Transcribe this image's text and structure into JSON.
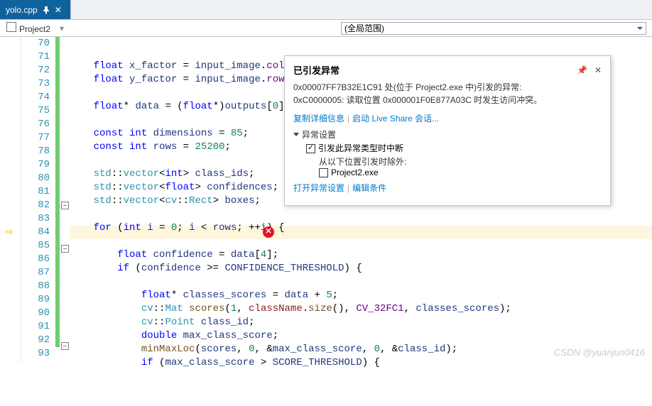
{
  "tab": {
    "name": "yolo.cpp"
  },
  "crumbs": {
    "project": "Project2",
    "scope": "(全局范围)"
  },
  "lineStart": 70,
  "highlightLine": 84,
  "codeLines": [
    {
      "n": 70,
      "g": 1,
      "html": "    <span class='kw'>float</span> <span class='id'>x_factor</span> <span class='op'>=</span> <span class='id'>input_image</span>.<span class='mem'>cols</span> <span class='op'>/</span> <span class='id'>INPUT_WIDTH</span>;"
    },
    {
      "n": 71,
      "g": 1,
      "html": "    <span class='kw'>float</span> <span class='id'>y_factor</span> <span class='op'>=</span> <span class='id'>input_image</span>.<span class='mem'>row</span>"
    },
    {
      "n": 72,
      "g": 1,
      "html": ""
    },
    {
      "n": 73,
      "g": 1,
      "html": "    <span class='kw'>float</span><span class='op'>*</span> <span class='id'>data</span> <span class='op'>=</span> (<span class='kw'>float</span><span class='op'>*</span>)<span class='id'>outputs</span>[<span class='num'>0</span>]"
    },
    {
      "n": 74,
      "g": 1,
      "html": ""
    },
    {
      "n": 75,
      "g": 1,
      "html": "    <span class='kw'>const</span> <span class='kw'>int</span> <span class='id'>dimensions</span> <span class='op'>=</span> <span class='num'>85</span>;"
    },
    {
      "n": 76,
      "g": 1,
      "html": "    <span class='kw'>const</span> <span class='kw'>int</span> <span class='id'>rows</span> <span class='op'>=</span> <span class='num'>25200</span>;"
    },
    {
      "n": 77,
      "g": 1,
      "html": ""
    },
    {
      "n": 78,
      "g": 1,
      "html": "    <span class='ty'>std</span>::<span class='ty'>vector</span>&lt;<span class='kw'>int</span>&gt; <span class='id'>class_ids</span>;"
    },
    {
      "n": 79,
      "g": 1,
      "html": "    <span class='ty'>std</span>::<span class='ty'>vector</span>&lt;<span class='kw'>float</span>&gt; <span class='id'>confidences</span>;"
    },
    {
      "n": 80,
      "g": 1,
      "html": "    <span class='ty'>std</span>::<span class='ty'>vector</span>&lt;<span class='ty'>cv</span>::<span class='ty'>Rect</span>&gt; <span class='id'>boxes</span>;"
    },
    {
      "n": 81,
      "g": 1,
      "html": ""
    },
    {
      "n": 82,
      "g": 1,
      "o": 1,
      "html": "    <span class='kw'>for</span> (<span class='kw'>int</span> <span class='id'>i</span> <span class='op'>=</span> <span class='num'>0</span>; <span class='id'>i</span> <span class='op'>&lt;</span> <span class='id'>rows</span>; <span class='op'>++</span><span class='id'>i</span>) {"
    },
    {
      "n": 83,
      "g": 1,
      "html": ""
    },
    {
      "n": 84,
      "g": 1,
      "html": "        <span class='kw'>float</span> <span class='id'>confidence</span> <span class='op'>=</span> <span class='id'>data</span>[<span class='num'>4</span>];"
    },
    {
      "n": 85,
      "g": 1,
      "o": 1,
      "html": "        <span class='kw'>if</span> (<span class='id'>confidence</span> <span class='op'>&gt;=</span> <span class='id'>CONFIDENCE_THRESHOLD</span>) {"
    },
    {
      "n": 86,
      "g": 1,
      "html": ""
    },
    {
      "n": 87,
      "g": 1,
      "html": "            <span class='kw'>float</span><span class='op'>*</span> <span class='id'>classes_scores</span> <span class='op'>=</span> <span class='id'>data</span> <span class='op'>+</span> <span class='num'>5</span>;"
    },
    {
      "n": 88,
      "g": 1,
      "html": "            <span class='ty'>cv</span>::<span class='ty'>Mat</span> <span class='fn'>scores</span>(<span class='num'>1</span>, <span class='darkred'>className</span>.<span class='fn'>size</span>(), <span class='mem'>CV_32FC1</span>, <span class='id'>classes_scores</span>);"
    },
    {
      "n": 89,
      "g": 1,
      "html": "            <span class='ty'>cv</span>::<span class='ty'>Point</span> <span class='id'>class_id</span>;"
    },
    {
      "n": 90,
      "g": 1,
      "html": "            <span class='kw'>double</span> <span class='id'>max_class_score</span>;"
    },
    {
      "n": 91,
      "g": 1,
      "html": "            <span class='fn'>minMaxLoc</span>(<span class='id'>scores</span>, <span class='num'>0</span>, <span class='op'>&amp;</span><span class='id'>max_class_score</span>, <span class='num'>0</span>, <span class='op'>&amp;</span><span class='id'>class_id</span>);"
    },
    {
      "n": 92,
      "g": 1,
      "o": 1,
      "html": "            <span class='kw'>if</span> (<span class='id'>max_class_score</span> <span class='op'>&gt;</span> <span class='id'>SCORE_THRESHOLD</span>) {"
    },
    {
      "n": 93,
      "g": 0,
      "html": ""
    }
  ],
  "tooltip": {
    "title": "已引发异常",
    "body1": "0x00007FF7B32E1C91 处(位于 Project2.exe 中)引发的异常:",
    "body2": "0xC0000005: 读取位置 0x000001F0E877A03C 时发生访问冲突。",
    "link1": "复制详细信息",
    "link2": "启动 Live Share 会话...",
    "sectionTitle": "异常设置",
    "cbx1Label": "引发此异常类型时中断",
    "cbx1Checked": true,
    "except": "从以下位置引发时除外:",
    "cbx2Label": "Project2.exe",
    "cbx2Checked": false,
    "link3": "打开异常设置",
    "link4": "编辑条件"
  },
  "watermark": "CSDN @yuanjun0416",
  "errGlyph": "✕"
}
